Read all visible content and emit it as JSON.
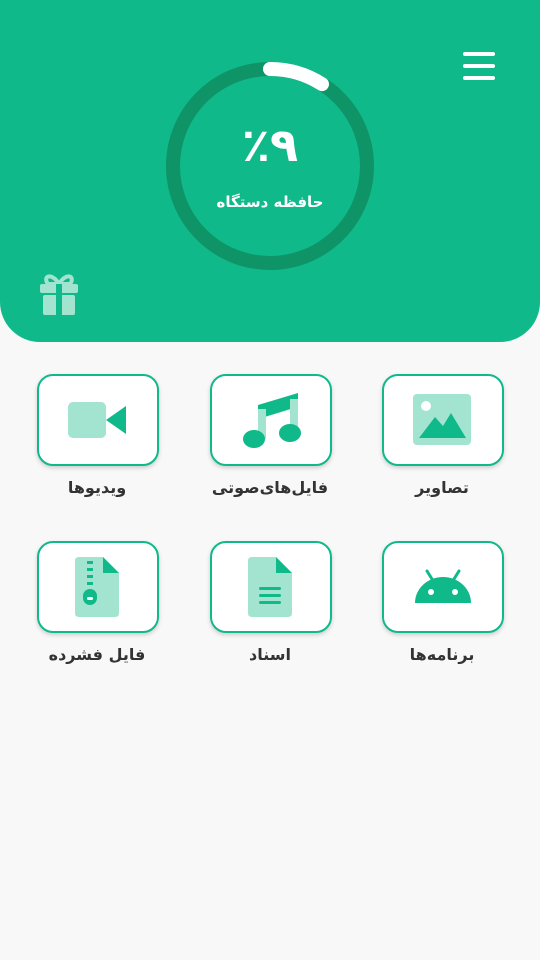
{
  "header": {
    "storage_percent_text": "٩٪",
    "storage_percent_value": 9,
    "storage_label": "حافظه دستگاه",
    "menu_icon": "hamburger-icon",
    "gift_icon": "gift-icon"
  },
  "categories": [
    {
      "label": "تصاویر",
      "icon": "image-icon"
    },
    {
      "label": "فایل‌های‌صوتی",
      "icon": "music-note-icon"
    },
    {
      "label": "ویدیوها",
      "icon": "video-camera-icon"
    },
    {
      "label": "برنامه‌ها",
      "icon": "android-icon"
    },
    {
      "label": "اسناد",
      "icon": "document-icon"
    },
    {
      "label": "فایل فشرده",
      "icon": "zip-file-icon"
    }
  ],
  "colors": {
    "primary": "#10b98a",
    "ring_track": "#0e9466",
    "ring_progress": "#ffffff",
    "icon_light": "#a3e4d1",
    "page_background": "#f8f8f8"
  }
}
